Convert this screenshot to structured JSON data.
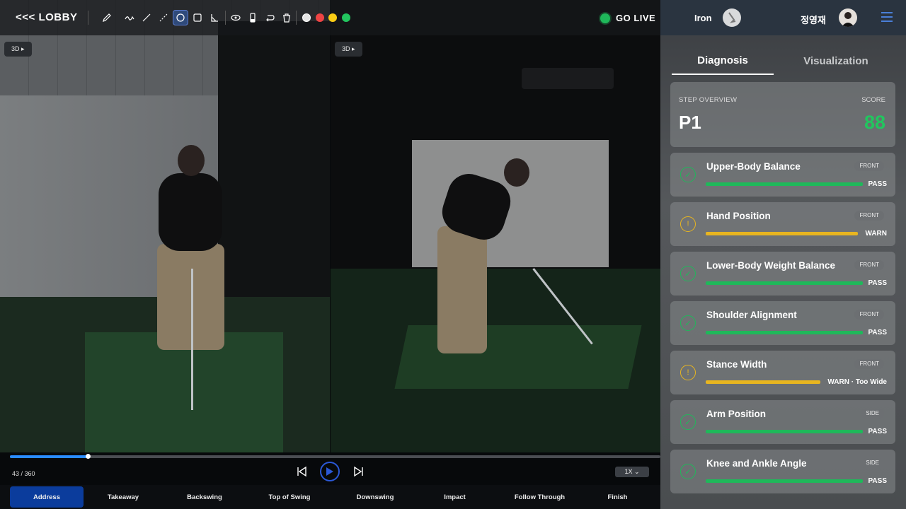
{
  "toolbar": {
    "lobby_label": "<<< LOBBY",
    "tools": [
      "pen-icon",
      "squiggle-icon",
      "line-icon",
      "dashed-line-icon",
      "circle-icon",
      "rectangle-icon",
      "angle-icon",
      "eye-icon",
      "eraser-icon",
      "undo-icon",
      "trash-icon"
    ],
    "active_tool": "circle-icon",
    "colors": [
      "#e5e5e5",
      "#ef4444",
      "#facc15",
      "#22c55e"
    ],
    "go_live_label": "GO LIVE"
  },
  "video": {
    "left_badge": "3D ▸",
    "right_badge": "3D ▸",
    "frame_counter": "43 / 360",
    "current_frame": 43,
    "total_frames": 360,
    "speed_label": "1X ⌄"
  },
  "phases": [
    "Address",
    "Takeaway",
    "Backswing",
    "Top of Swing",
    "Downswing",
    "Impact",
    "Follow Through",
    "Finish"
  ],
  "active_phase": "Address",
  "panel": {
    "club_label": "Iron",
    "user_name": "정영재",
    "tabs": {
      "diagnosis": "Diagnosis",
      "visualization": "Visualization"
    },
    "overview": {
      "label": "STEP OVERVIEW",
      "step": "P1",
      "score_label": "SCORE",
      "score": "88"
    },
    "items": [
      {
        "title": "Upper-Body Balance",
        "view": "FRONT",
        "status": "pass",
        "result": "PASS",
        "level": 1.0
      },
      {
        "title": "Hand Position",
        "view": "FRONT",
        "status": "warn",
        "result": "WARN",
        "level": 0.97
      },
      {
        "title": "Lower-Body Weight Balance",
        "view": "FRONT",
        "status": "pass",
        "result": "PASS",
        "level": 1.0
      },
      {
        "title": "Shoulder Alignment",
        "view": "FRONT",
        "status": "pass",
        "result": "PASS",
        "level": 1.0
      },
      {
        "title": "Stance Width",
        "view": "FRONT",
        "status": "warn",
        "result": "WARN · Too Wide",
        "level": 0.73
      },
      {
        "title": "Arm Position",
        "view": "SIDE",
        "status": "pass",
        "result": "PASS",
        "level": 1.0
      },
      {
        "title": "Knee and Ankle Angle",
        "view": "SIDE",
        "status": "pass",
        "result": "PASS",
        "level": 1.0
      }
    ]
  }
}
